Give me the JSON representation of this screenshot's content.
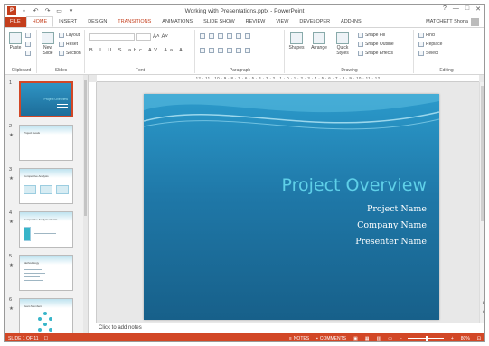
{
  "window": {
    "doc_title": "Working with Presentations.pptx - PowerPoint",
    "app_badge": "P",
    "controls": [
      "?",
      "—",
      "□",
      "✕"
    ]
  },
  "tabs": [
    "FILE",
    "HOME",
    "INSERT",
    "DESIGN",
    "TRANSITIONS",
    "ANIMATIONS",
    "SLIDE SHOW",
    "REVIEW",
    "VIEW",
    "DEVELOPER",
    "ADD-INS"
  ],
  "user": {
    "name": "MATCHETT Shona"
  },
  "ribbon": {
    "clipboard": {
      "label": "Clipboard",
      "paste": "Paste"
    },
    "slides": {
      "label": "Slides",
      "new_slide": "New Slide",
      "layout": "Layout",
      "reset": "Reset",
      "section": "Section"
    },
    "font": {
      "label": "Font",
      "format_row": "B I U S abc AV Aa A"
    },
    "paragraph": {
      "label": "Paragraph"
    },
    "drawing": {
      "label": "Drawing",
      "shapes": "Shapes",
      "arrange": "Arrange",
      "quick_styles": "Quick Styles",
      "fill": "Shape Fill",
      "outline": "Shape Outline",
      "effects": "Shape Effects"
    },
    "editing": {
      "label": "Editing",
      "find": "Find",
      "replace": "Replace",
      "select": "Select"
    }
  },
  "ruler": {
    "ticks": "12 · 11 · 10 · 9 · 8 · 7 · 6 · 5 · 4 · 3 · 2 · 1 · 0 · 1 · 2 · 3 · 4 · 5 · 6 · 7 · 8 · 9 · 10 · 11 · 12"
  },
  "slide": {
    "title": "Project Overview",
    "lines": [
      "Project Name",
      "Company Name",
      "Presenter Name"
    ]
  },
  "thumbnails": [
    {
      "num": "1",
      "title": "Project Overview",
      "selected": true
    },
    {
      "num": "2",
      "title": "Project Goals",
      "selected": false
    },
    {
      "num": "3",
      "title": "Competitive Analysis",
      "selected": false
    },
    {
      "num": "4",
      "title": "Competitive Analysis Charts",
      "selected": false
    },
    {
      "num": "5",
      "title": "Methodology",
      "selected": false
    },
    {
      "num": "6",
      "title": "Team Members",
      "selected": false
    }
  ],
  "notes": {
    "placeholder": "Click to add notes"
  },
  "status": {
    "slide_info": "SLIDE 1 OF 11",
    "notes": "NOTES",
    "comments": "COMMENTS",
    "zoom": "80%",
    "zoom_level": 0.5
  },
  "colors": {
    "accent": "#d24726",
    "slide_top": "#2b9acb",
    "slide_bottom": "#17608a",
    "title_color": "#5fd0e8"
  }
}
